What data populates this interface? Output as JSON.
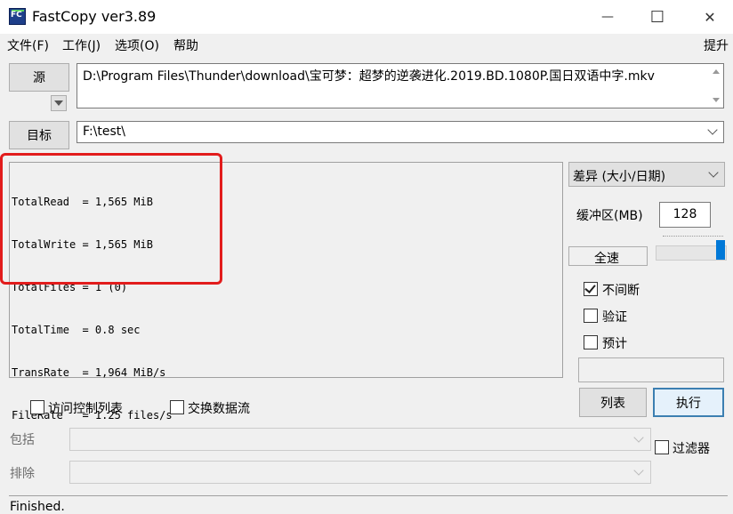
{
  "window": {
    "title": "FastCopy ver3.89",
    "icon": "fastcopy-icon",
    "minimize": "—",
    "maximize": "☐",
    "close": "✕"
  },
  "menu": {
    "items": [
      "文件(F)",
      "工作(J)",
      "选项(O)",
      "帮助"
    ],
    "right": "提升"
  },
  "source": {
    "button": "源",
    "path": "D:\\Program Files\\Thunder\\download\\宝可梦：超梦的逆袭进化.2019.BD.1080P.国日双语中字.mkv"
  },
  "dest": {
    "button": "目标",
    "path": "F:\\test\\"
  },
  "log": {
    "lines": [
      "TotalRead  = 1,565 MiB",
      "TotalWrite = 1,565 MiB",
      "TotalFiles = 1 (0)",
      "TotalTime  = 0.8 sec",
      "TransRate  = 1,964 MiB/s",
      "FileRate   = 1.25 files/s"
    ]
  },
  "mode": {
    "selected": "差异 (大小/日期)"
  },
  "buffer": {
    "label": "缓冲区(MB)",
    "value": "128"
  },
  "speed": {
    "label": "全速",
    "slider_level": 1.0
  },
  "options": {
    "nonstop": {
      "label": "不间断",
      "checked": true
    },
    "verify": {
      "label": "验证",
      "checked": false
    },
    "estimate": {
      "label": "预计",
      "checked": false
    }
  },
  "actions": {
    "list": "列表",
    "execute": "执行"
  },
  "bottom": {
    "acl": {
      "label": "访问控制列表",
      "checked": false
    },
    "streams": {
      "label": "交换数据流",
      "checked": false
    },
    "include_label": "包括",
    "exclude_label": "排除",
    "filter": {
      "label": "过滤器",
      "checked": false
    }
  },
  "status": {
    "text": "Finished."
  },
  "colors": {
    "highlight": "#e21c1c",
    "primary_border": "#3c7fb1",
    "slider_thumb": "#0078d7"
  }
}
